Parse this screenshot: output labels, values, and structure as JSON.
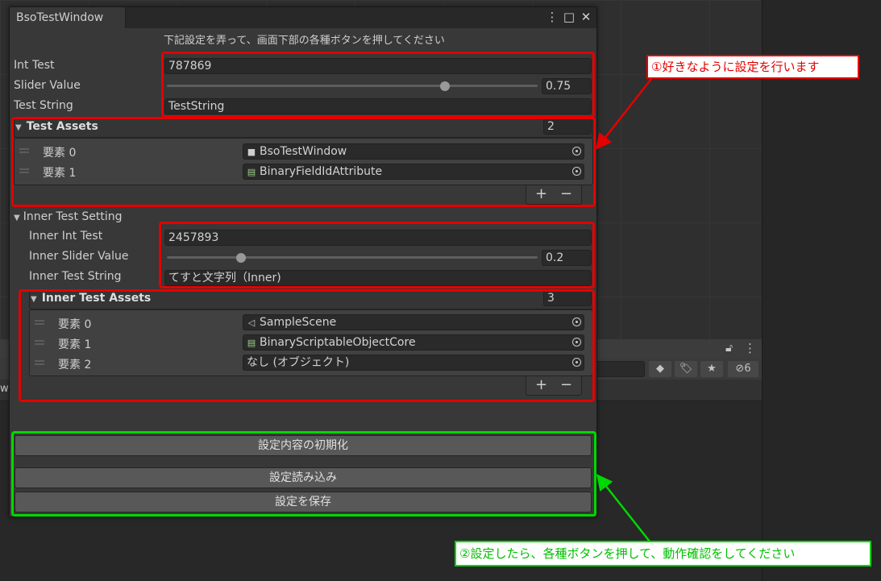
{
  "window": {
    "title": "BsoTestWindow",
    "instruction": "下記設定を弄って、画面下部の各種ボタンを押してください"
  },
  "settings": {
    "int_label": "Int Test",
    "int_value": "787869",
    "slider_label": "Slider Value",
    "slider_value": "0.75",
    "slider_fraction": 0.75,
    "string_label": "Test String",
    "string_value": "TestString"
  },
  "test_assets": {
    "label": "Test Assets",
    "count": "2",
    "items": [
      {
        "label": "要素 0",
        "value": "BsoTestWindow",
        "icon": "folder-icon"
      },
      {
        "label": "要素 1",
        "value": "BinaryFieldIdAttribute",
        "icon": "script-icon"
      }
    ]
  },
  "inner": {
    "label": "Inner Test Setting",
    "int_label": "Inner Int Test",
    "int_value": "2457893",
    "slider_label": "Inner Slider Value",
    "slider_value": "0.2",
    "slider_fraction": 0.2,
    "string_label": "Inner Test String",
    "string_value": "てすと文字列（Inner)",
    "assets": {
      "label": "Inner Test Assets",
      "count": "3",
      "items": [
        {
          "label": "要素 0",
          "value": "SampleScene",
          "icon": "scene-icon"
        },
        {
          "label": "要素 1",
          "value": "BinaryScriptableObjectCore",
          "icon": "script-icon"
        },
        {
          "label": "要素 2",
          "value": "なし (オブジェクト)",
          "icon": ""
        }
      ]
    }
  },
  "buttons": {
    "reset": "設定内容の初期化",
    "load": "設定読み込み",
    "save": "設定を保存"
  },
  "annotations": {
    "step1": "①好きなように設定を行います",
    "step2": "②設定したら、各種ボタンを押して、動作確認をしてください"
  },
  "background": {
    "hidden_count": "6",
    "partial_label": "w"
  },
  "colors": {
    "annotation_red": "#e40000",
    "annotation_green": "#00d800"
  }
}
